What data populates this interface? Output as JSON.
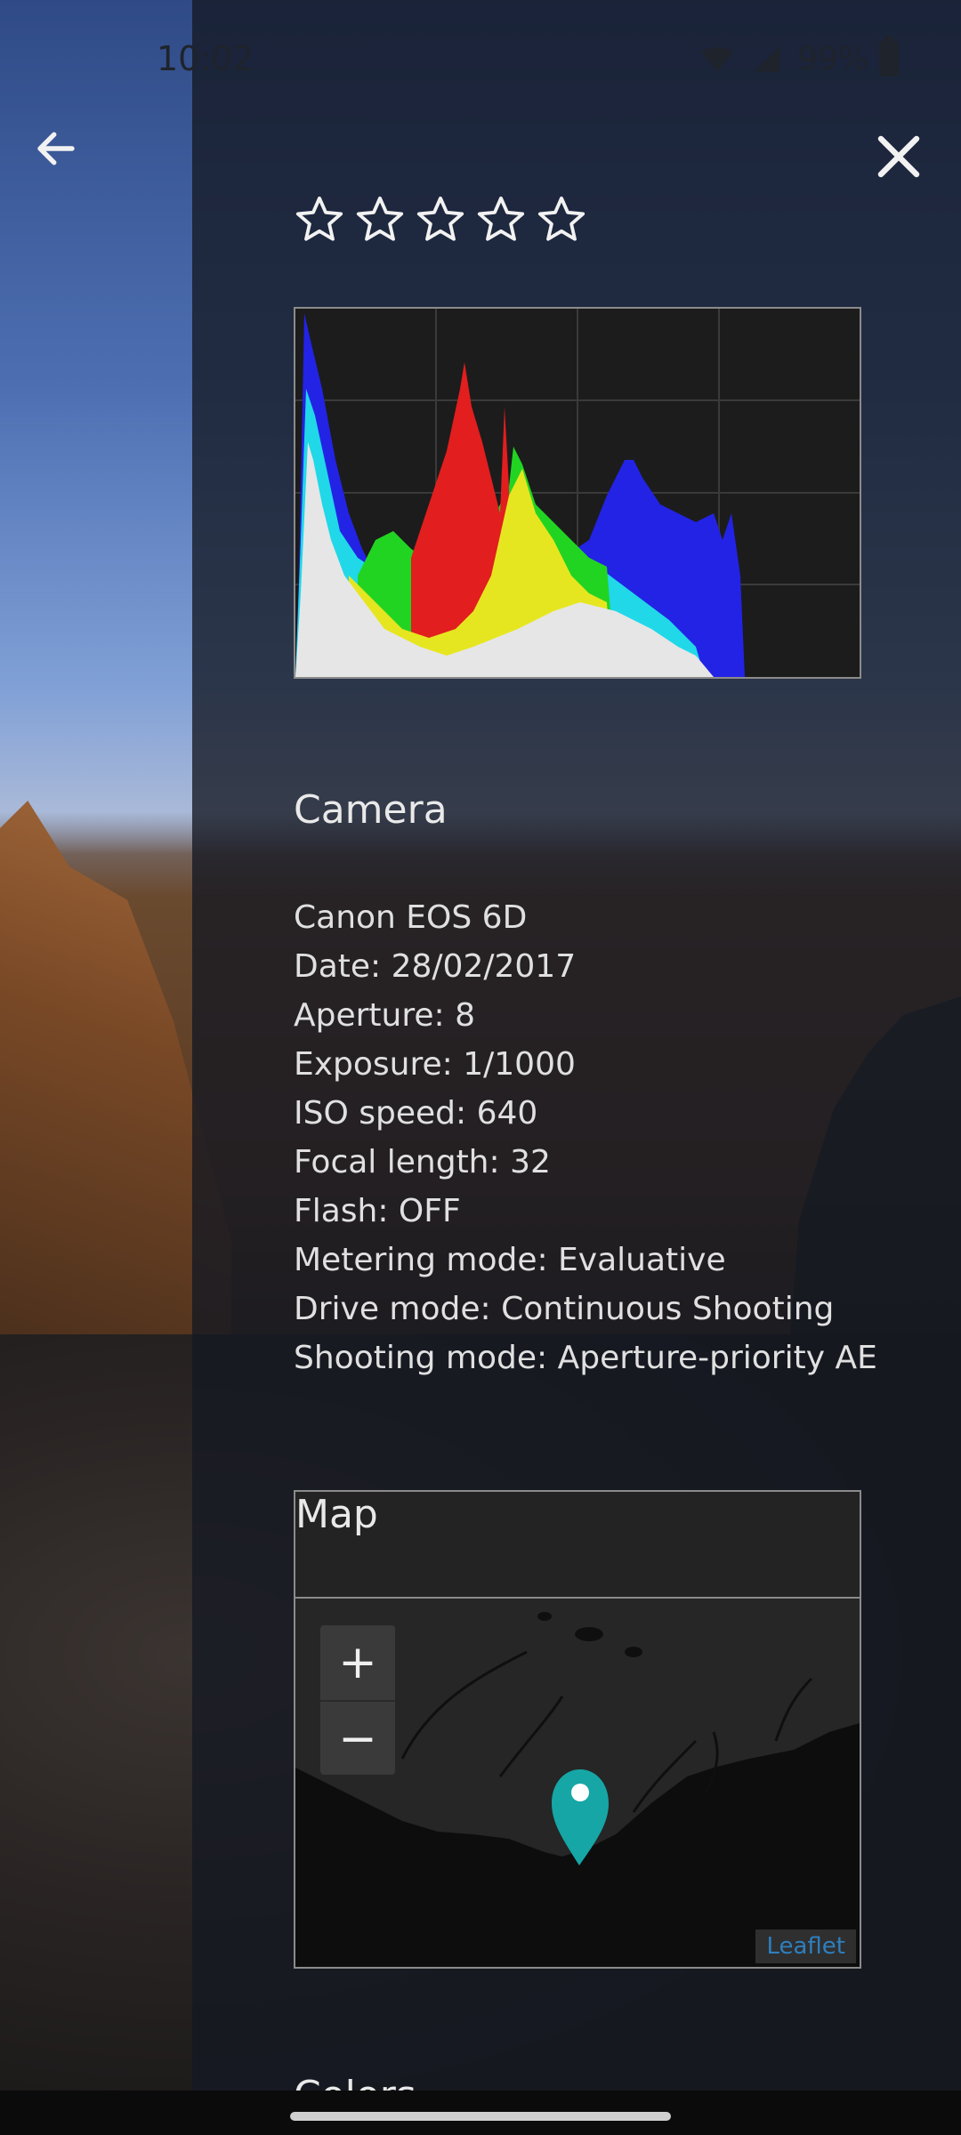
{
  "status_bar": {
    "time": "10:02",
    "battery": "99%"
  },
  "icons": {
    "back": "arrow-left-icon",
    "close": "close-icon",
    "zoom_in": "+",
    "zoom_out": "−",
    "marker": "map-marker-icon"
  },
  "rating": {
    "stars_total": 5,
    "stars_filled": 0
  },
  "histogram": {
    "title": "",
    "grid": true
  },
  "camera": {
    "title": "Camera",
    "lines": [
      "Canon EOS 6D",
      "Date: 28/02/2017",
      "Aperture: 8",
      "Exposure: 1/1000",
      "ISO speed: 640",
      "Focal length: 32",
      "Flash: OFF",
      "Metering mode: Evaluative",
      "Drive mode: Continuous Shooting",
      "Shooting mode: Aperture-priority AE"
    ]
  },
  "map": {
    "title": "Map",
    "attribution": "Leaflet"
  },
  "next_section": {
    "title": "Colors"
  },
  "colors": {
    "drawer_bg": "#141822",
    "text": "#e0e0e0",
    "marker": "#16a6a6",
    "leaflet": "#2d7fbf"
  }
}
